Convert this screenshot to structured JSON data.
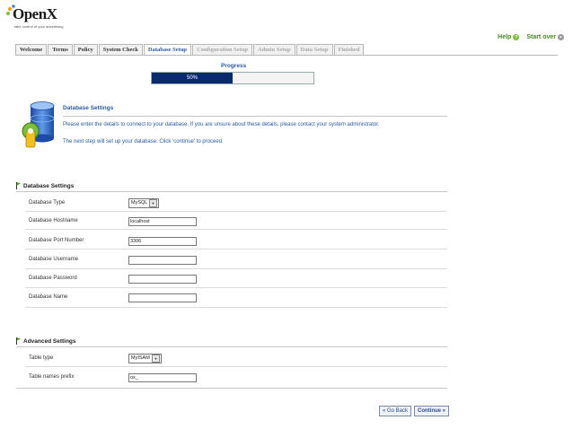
{
  "brand": {
    "name": "OpenX",
    "tagline": "take control of your advertising"
  },
  "toplinks": {
    "help": "Help",
    "start_over": "Start over"
  },
  "tabs": [
    {
      "label": "Welcome",
      "state": "done"
    },
    {
      "label": "Terms",
      "state": "done"
    },
    {
      "label": "Policy",
      "state": "done"
    },
    {
      "label": "System Check",
      "state": "done"
    },
    {
      "label": "Database Setup",
      "state": "active"
    },
    {
      "label": "Configuration Setup",
      "state": "disabled"
    },
    {
      "label": "Admin Setup",
      "state": "disabled"
    },
    {
      "label": "Data Setup",
      "state": "disabled"
    },
    {
      "label": "Finished",
      "state": "disabled"
    }
  ],
  "progress": {
    "label": "Progress",
    "value_text": "50%",
    "fraction": 0.5
  },
  "intro": {
    "title": "Database Settings",
    "p1": "Please enter the details to connect to your database. If you are unsure about these details, please contact your system administrator.",
    "p2": "The next step will set up your database. Click 'continue' to proceed."
  },
  "db_section": {
    "title": "Database Settings",
    "fields": {
      "type": {
        "label": "Database Type",
        "value": "MySQL"
      },
      "hostname": {
        "label": "Database Hostname",
        "value": "localhost"
      },
      "port": {
        "label": "Database Port Number",
        "value": "3306"
      },
      "username": {
        "label": "Database Username",
        "value": ""
      },
      "password": {
        "label": "Database Password",
        "value": ""
      },
      "name": {
        "label": "Database Name",
        "value": ""
      }
    }
  },
  "adv_section": {
    "title": "Advanced Settings",
    "fields": {
      "table_type": {
        "label": "Table type",
        "value": "MyISAM"
      },
      "prefix": {
        "label": "Table names prefix",
        "value": "ox_"
      }
    }
  },
  "buttons": {
    "back": "« Go Back",
    "continue": "Continue »"
  },
  "colors": {
    "accent_blue": "#2a5aa5",
    "progress_fill": "#0a2a6e",
    "help_green": "#4a8a1a"
  }
}
